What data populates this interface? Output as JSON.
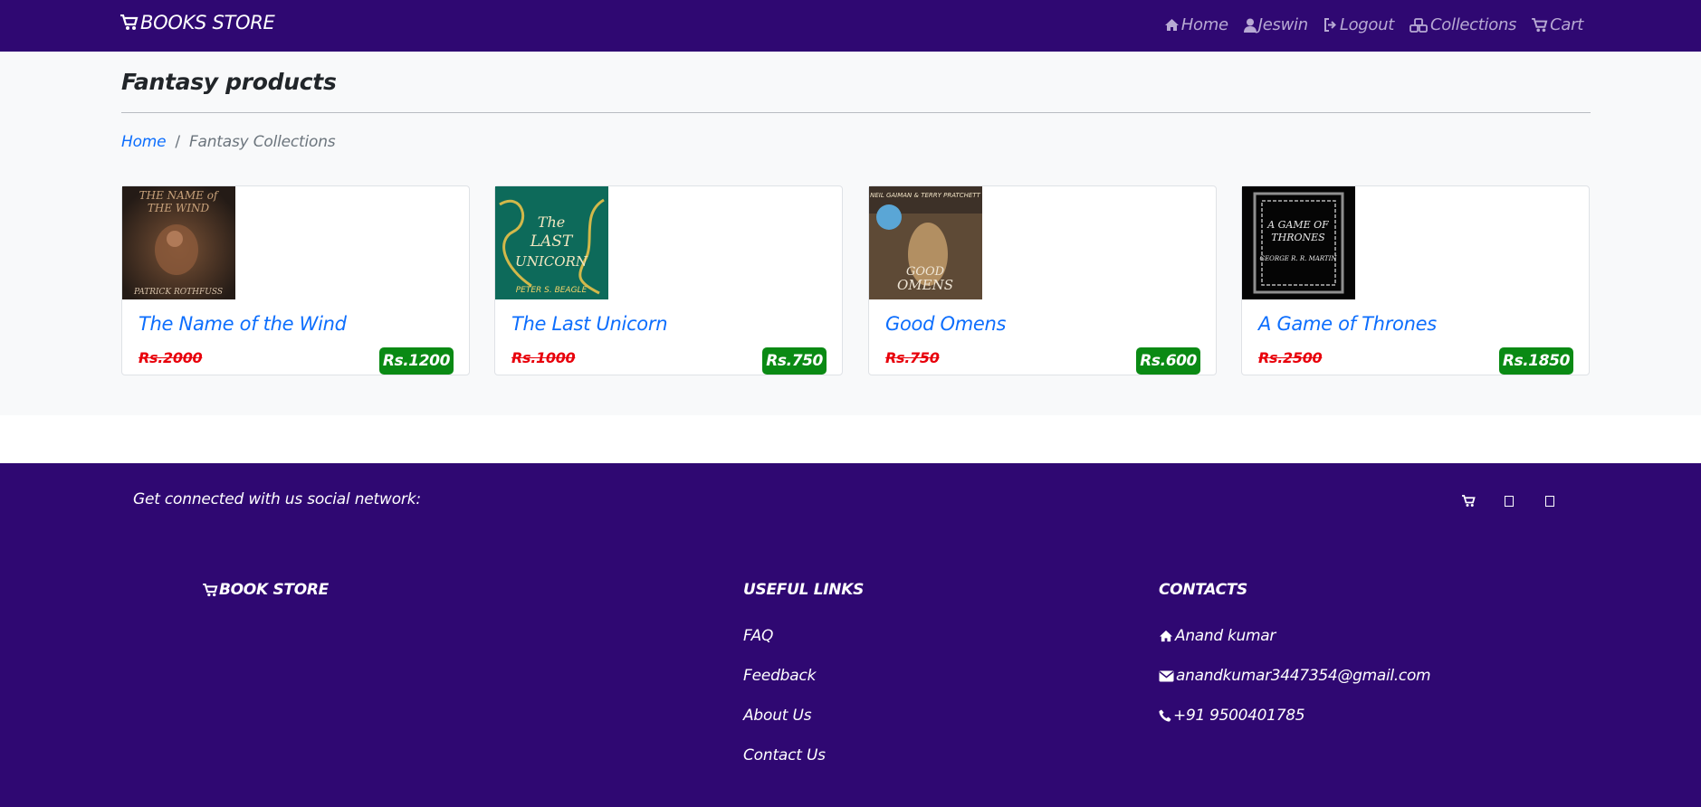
{
  "navbar": {
    "brand": "BOOKS STORE",
    "links": [
      {
        "label": "Home",
        "icon": "home-icon"
      },
      {
        "label": "Jeswin",
        "icon": "user-icon"
      },
      {
        "label": "Logout",
        "icon": "logout-icon"
      },
      {
        "label": "Collections",
        "icon": "cubes-icon"
      },
      {
        "label": "Cart",
        "icon": "cart-icon"
      }
    ]
  },
  "page": {
    "title": "Fantasy products",
    "breadcrumb": {
      "home": "Home",
      "separator": "/",
      "current": "Fantasy Collections"
    }
  },
  "products": [
    {
      "title": "The Name of the Wind",
      "old_price": "Rs.2000",
      "price": "Rs.1200",
      "cover": {
        "title_line1": "THE NAME of",
        "title_line2": "THE WIND",
        "author": "PATRICK ROTHFUSS"
      }
    },
    {
      "title": "The Last Unicorn",
      "old_price": "Rs.1000",
      "price": "Rs.750",
      "cover": {
        "title_line1": "The",
        "title_line2": "LAST",
        "title_line3": "UNICORN",
        "author": "PETER S. BEAGLE"
      }
    },
    {
      "title": "Good Omens",
      "old_price": "Rs.750",
      "price": "Rs.600",
      "cover": {
        "author": "NEIL GAIMAN & TERRY PRATCHETT",
        "title_line1": "GOOD",
        "title_line2": "OMENS"
      }
    },
    {
      "title": "A Game of Thrones",
      "old_price": "Rs.2500",
      "price": "Rs.1850",
      "cover": {
        "title_line1": "A GAME OF",
        "title_line2": "THRONES",
        "author": "GEORGE R. R. MARTIN"
      }
    }
  ],
  "footer": {
    "social_text": "Get connected with us social network:",
    "brand": "BOOK STORE",
    "useful_links_heading": "USEFUL LINKS",
    "links": [
      "FAQ",
      "Feedback",
      "About Us",
      "Contact Us"
    ],
    "contacts_heading": "CONTACTS",
    "contacts": {
      "name": "Anand kumar",
      "email": "anandkumar3447354@gmail.com",
      "phone": "+91 9500401785"
    }
  },
  "colors": {
    "primary": "#2f0872",
    "link": "#0d6efd",
    "price_badge": "#0a8a14",
    "old_price": "#e8000b",
    "nav_text": "#b7a9d3",
    "background": "#f8f9fa"
  }
}
